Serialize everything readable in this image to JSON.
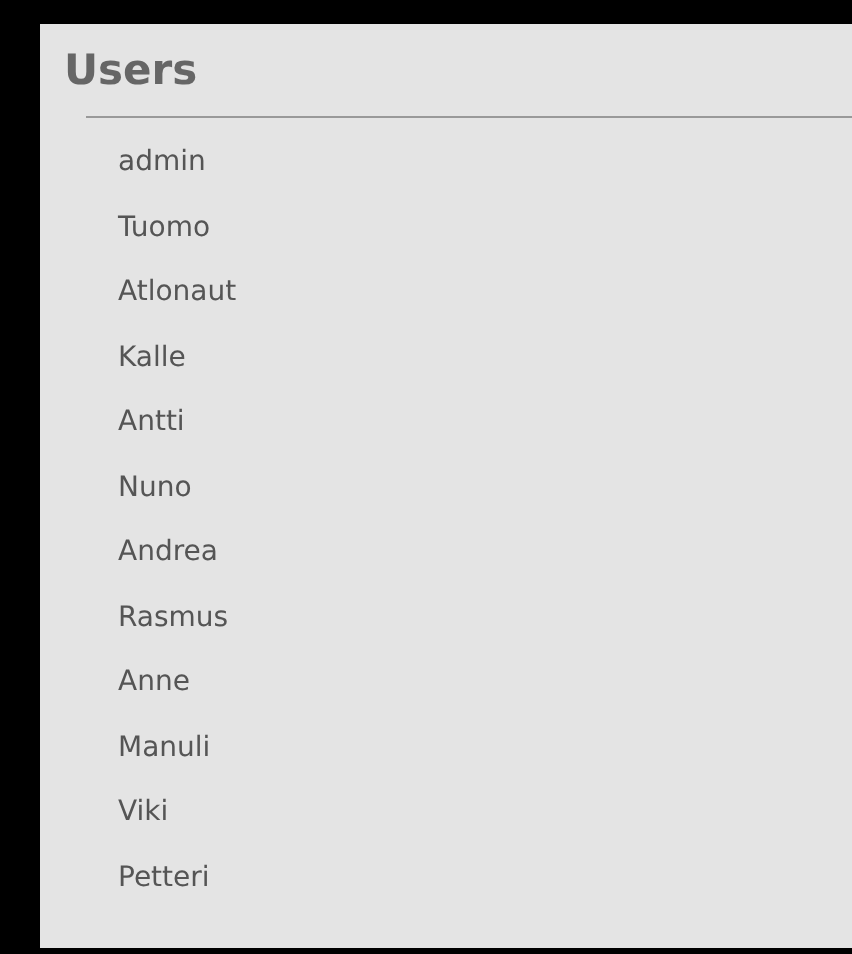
{
  "title": "Users",
  "users": [
    "admin",
    "Tuomo",
    "Atlonaut",
    "Kalle",
    "Antti",
    "Nuno",
    "Andrea",
    "Rasmus",
    "Anne",
    "Manuli",
    "Viki",
    "Petteri"
  ]
}
